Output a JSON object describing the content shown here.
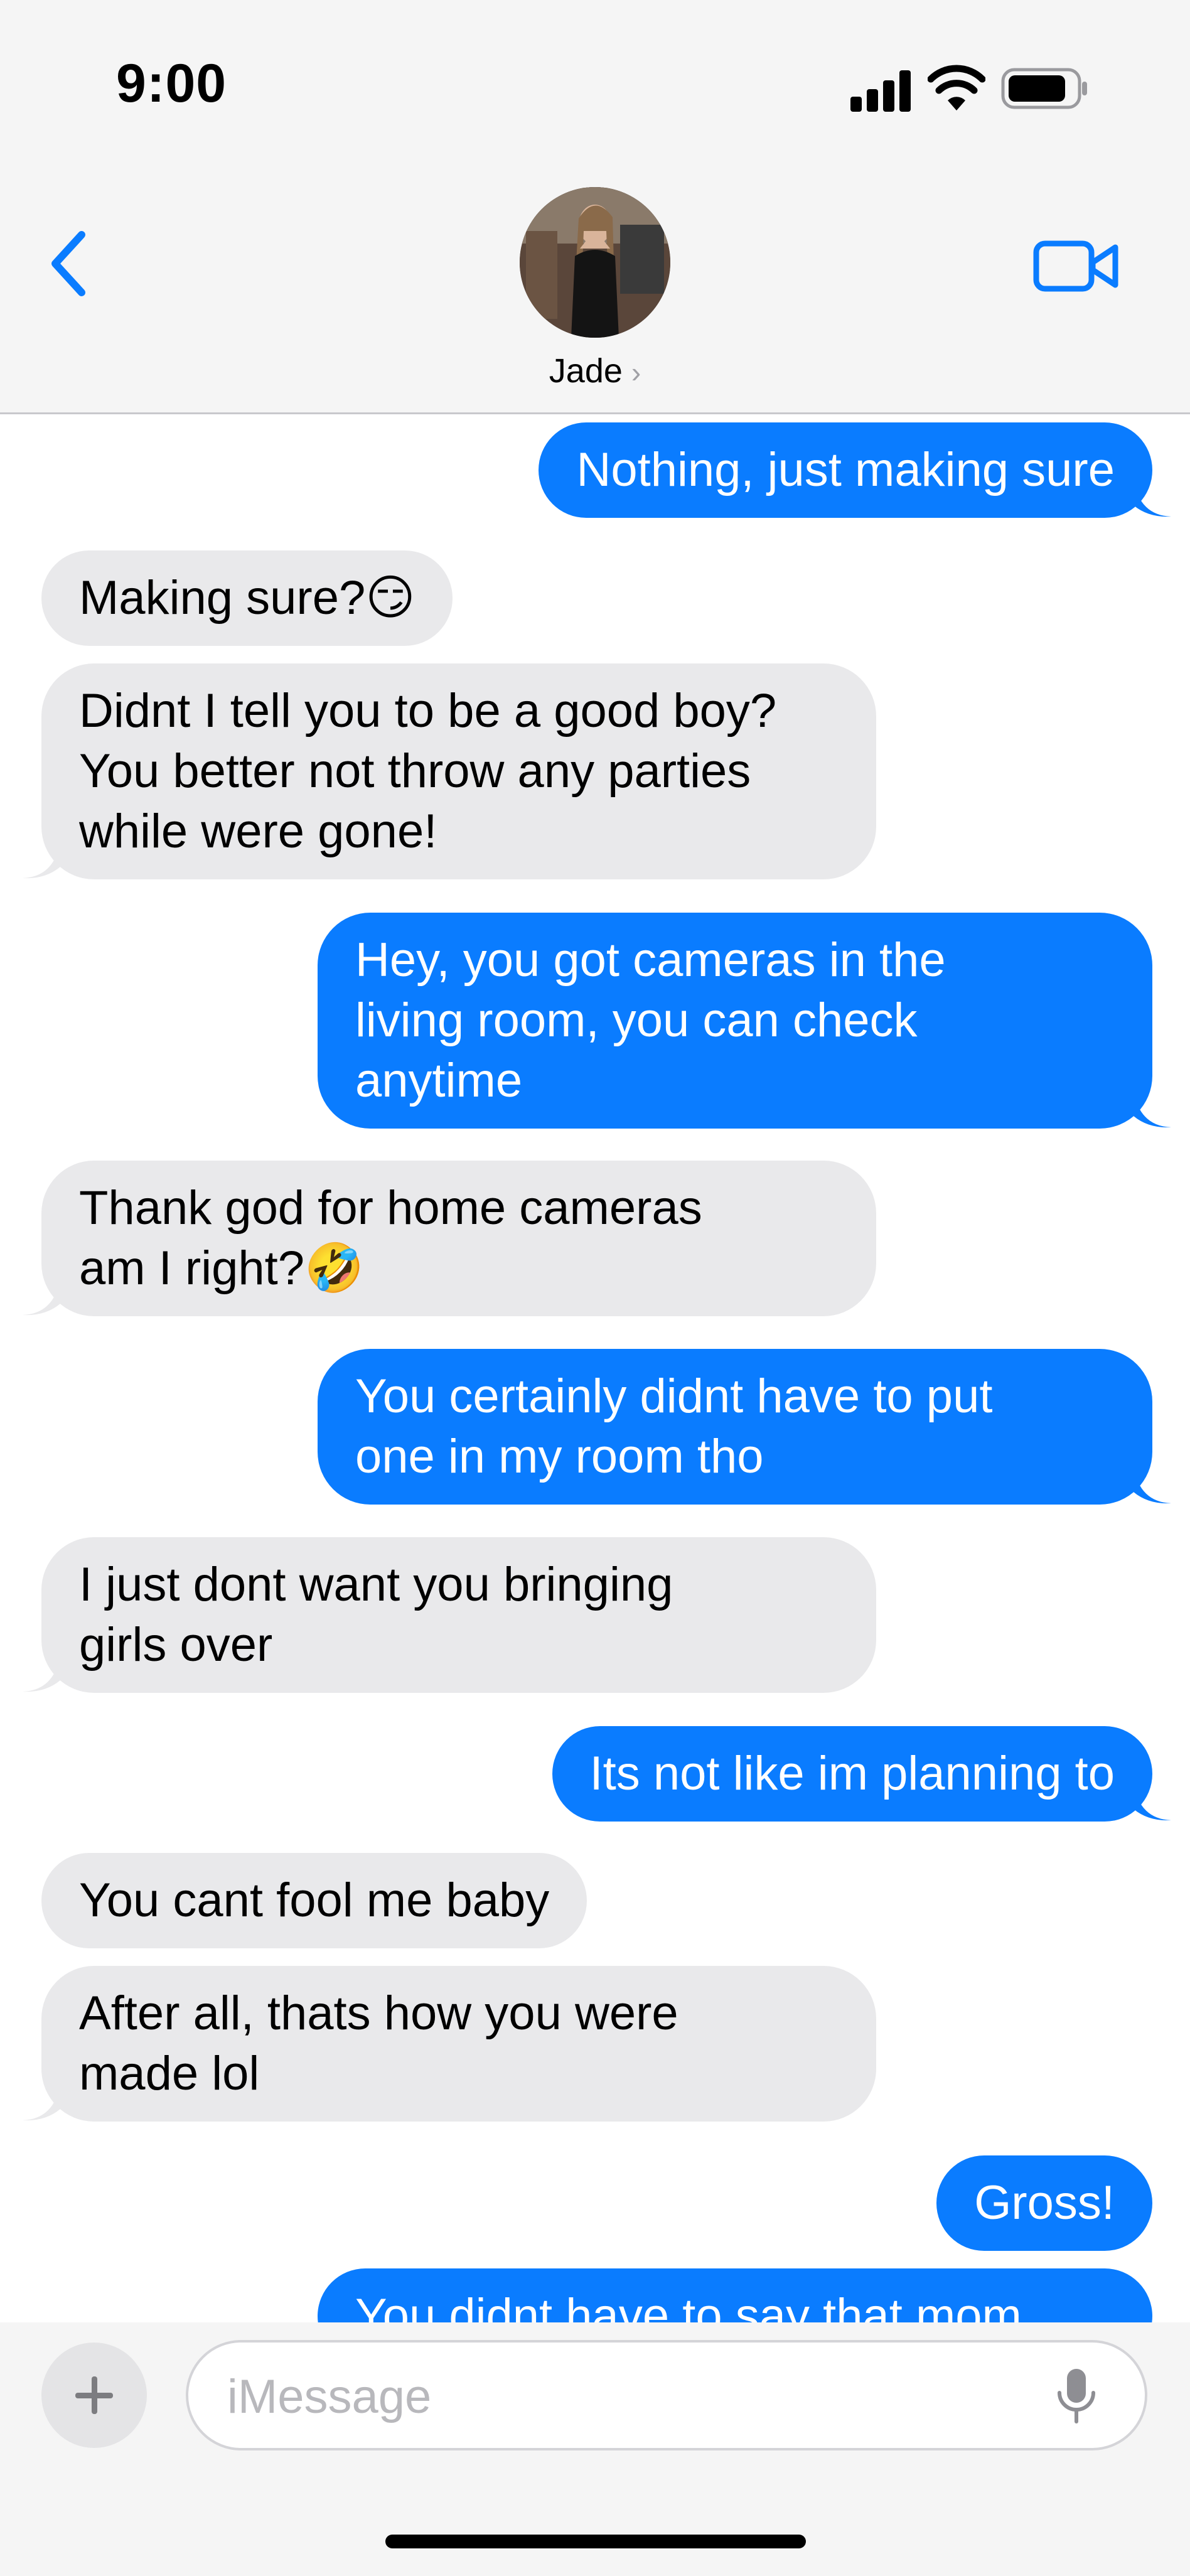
{
  "status_bar": {
    "time": "9:00"
  },
  "header": {
    "contact_name": "Jade",
    "name_chevron": "›",
    "back_icon": "chevron-left-icon",
    "video_icon": "video-camera-icon"
  },
  "colors": {
    "outgoing_bubble": "#0a7cff",
    "incoming_bubble": "#e9e9eb",
    "accent": "#0a7cff"
  },
  "messages": [
    {
      "direction": "out",
      "lines": [
        "Nothing, just making sure"
      ]
    },
    {
      "direction": "in",
      "lines": [
        "Making sure?😏"
      ]
    },
    {
      "direction": "in",
      "lines": [
        "Didnt I tell you to be a good boy?",
        "You better not throw any parties",
        "while were gone!"
      ]
    },
    {
      "direction": "out",
      "lines": [
        "Hey, you got cameras in the",
        "living room, you can check",
        "anytime"
      ]
    },
    {
      "direction": "in",
      "lines": [
        "Thank god for home cameras",
        "am I right?🤣"
      ]
    },
    {
      "direction": "out",
      "lines": [
        "You certainly didnt have to put",
        "one in my room tho"
      ]
    },
    {
      "direction": "in",
      "lines": [
        "I just dont want you bringing",
        "girls over"
      ]
    },
    {
      "direction": "out",
      "lines": [
        "Its not like im planning to"
      ]
    },
    {
      "direction": "in",
      "lines": [
        "You cant fool me baby"
      ]
    },
    {
      "direction": "in",
      "lines": [
        "After all, thats how you were",
        "made lol"
      ]
    },
    {
      "direction": "out",
      "lines": [
        "Gross!"
      ]
    },
    {
      "direction": "out",
      "lines": [
        "You didnt have to say that mom"
      ]
    }
  ],
  "composer": {
    "placeholder": "iMessage",
    "plus_icon": "plus-icon",
    "mic_icon": "microphone-icon"
  }
}
